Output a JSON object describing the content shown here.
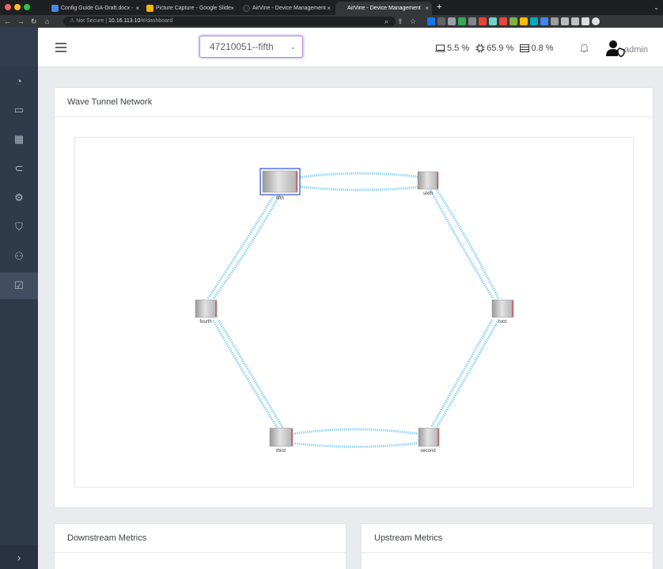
{
  "browser": {
    "tabs": [
      {
        "label": "Config Guide GA-Draft.docx -",
        "active": false,
        "icon_color": "#4a86e8"
      },
      {
        "label": "Picture Capture - Google Slide",
        "active": false,
        "icon_color": "#f4b400"
      },
      {
        "label": "AirVine - Device Management",
        "active": false,
        "icon_color": "#2a2a2a"
      },
      {
        "label": "AirVine - Device Management",
        "active": true,
        "icon_color": "#35363a"
      }
    ],
    "new_tab": "+",
    "tab_close": "×",
    "address": {
      "security": "Not Secure",
      "host": "10.16.113.10",
      "path": "/#/dashboard"
    }
  },
  "sidebar": {
    "items": [
      {
        "name": "sidebar-item-dashboard",
        "icon": "gauge-icon",
        "glyph": "◔",
        "active": false
      },
      {
        "name": "sidebar-item-devices",
        "icon": "laptop-icon",
        "glyph": "▭",
        "active": false
      },
      {
        "name": "sidebar-item-calendar",
        "icon": "calendar-icon",
        "glyph": "▦",
        "active": false
      },
      {
        "name": "sidebar-item-back",
        "icon": "circle-left-icon",
        "glyph": "⊂",
        "active": false
      },
      {
        "name": "sidebar-item-settings",
        "icon": "gear-icon",
        "glyph": "⚙",
        "active": false
      },
      {
        "name": "sidebar-item-security",
        "icon": "shield-icon",
        "glyph": "⛉",
        "active": false
      },
      {
        "name": "sidebar-item-users",
        "icon": "users-icon",
        "glyph": "⚇",
        "active": false
      },
      {
        "name": "sidebar-item-tasks",
        "icon": "checkbox-icon",
        "glyph": "☑",
        "active": true
      }
    ],
    "expand_glyph": "›"
  },
  "header": {
    "selected_device": "47210051--fifth",
    "caret": "⌄",
    "stats": {
      "cpu": "5.5 %",
      "memory": "65.9 %",
      "disk": "0.8 %"
    },
    "user": "admin"
  },
  "network_card": {
    "title": "Wave Tunnel Network",
    "nodes": [
      {
        "id": "fifth",
        "label": "fifth",
        "selected": true
      },
      {
        "id": "sixth",
        "label": "sixth",
        "selected": false
      },
      {
        "id": "root",
        "label": "root",
        "selected": false
      },
      {
        "id": "second",
        "label": "second",
        "selected": false
      },
      {
        "id": "third",
        "label": "third",
        "selected": false
      },
      {
        "id": "fourth",
        "label": "fourth",
        "selected": false
      }
    ],
    "links": [
      [
        "fifth",
        "sixth"
      ],
      [
        "sixth",
        "root"
      ],
      [
        "root",
        "second"
      ],
      [
        "second",
        "third"
      ],
      [
        "third",
        "fourth"
      ],
      [
        "fourth",
        "fifth"
      ]
    ]
  },
  "downstream_card": {
    "title": "Downstream Metrics"
  },
  "upstream_card": {
    "title": "Upstream Metrics"
  },
  "colors": {
    "sidebar": "#2f3a4b",
    "link": "#8fd2f3",
    "select_border": "#a78bd8",
    "selected_node": "#3b5bdb"
  }
}
